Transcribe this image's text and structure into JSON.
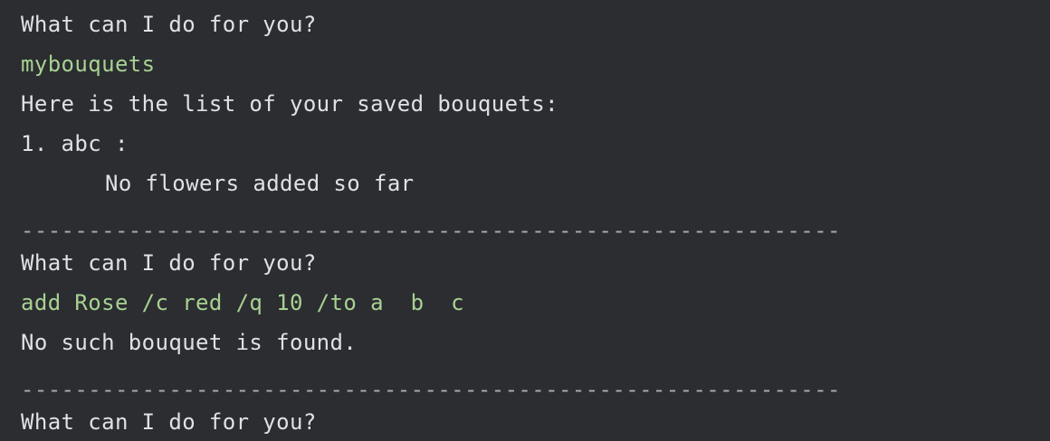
{
  "terminal": {
    "lines": [
      {
        "kind": "prompt",
        "text": "What can I do for you?"
      },
      {
        "kind": "input",
        "text": "mybouquets"
      },
      {
        "kind": "output",
        "text": "Here is the list of your saved bouquets:"
      },
      {
        "kind": "output",
        "text": "1. abc :"
      },
      {
        "kind": "output",
        "text": "No flowers added so far"
      },
      {
        "kind": "separator",
        "text": "-------------------------------------------------------------"
      },
      {
        "kind": "prompt",
        "text": "What can I do for you?"
      },
      {
        "kind": "input",
        "text": "add Rose /c red /q 10 /to a  b  c"
      },
      {
        "kind": "output",
        "text": "No such bouquet is found."
      },
      {
        "kind": "separator",
        "text": "-------------------------------------------------------------"
      },
      {
        "kind": "prompt",
        "text": "What can I do for you?"
      }
    ]
  },
  "colors": {
    "background": "#2b2d30",
    "text": "#dfe1e5",
    "user_input": "#a8d193"
  }
}
